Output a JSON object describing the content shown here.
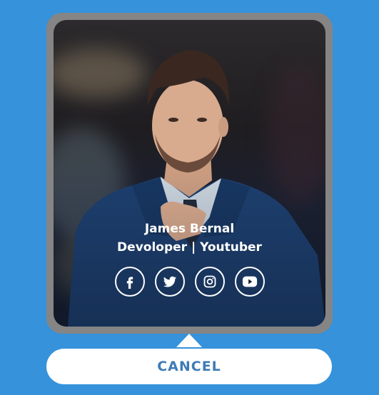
{
  "profile": {
    "name": "James Bernal",
    "role": "Devoloper | Youtuber",
    "photo_subject": "man-in-suit-adjusting-tie"
  },
  "socials": [
    {
      "icon": "facebook-icon"
    },
    {
      "icon": "twitter-icon"
    },
    {
      "icon": "instagram-icon"
    },
    {
      "icon": "youtube-icon"
    }
  ],
  "cancel_button": {
    "label": "CANCEL"
  },
  "colors": {
    "background": "#3592db",
    "card_frame": "#858585",
    "button_text": "#3e7bb6",
    "suit": "#1d3f6e"
  }
}
